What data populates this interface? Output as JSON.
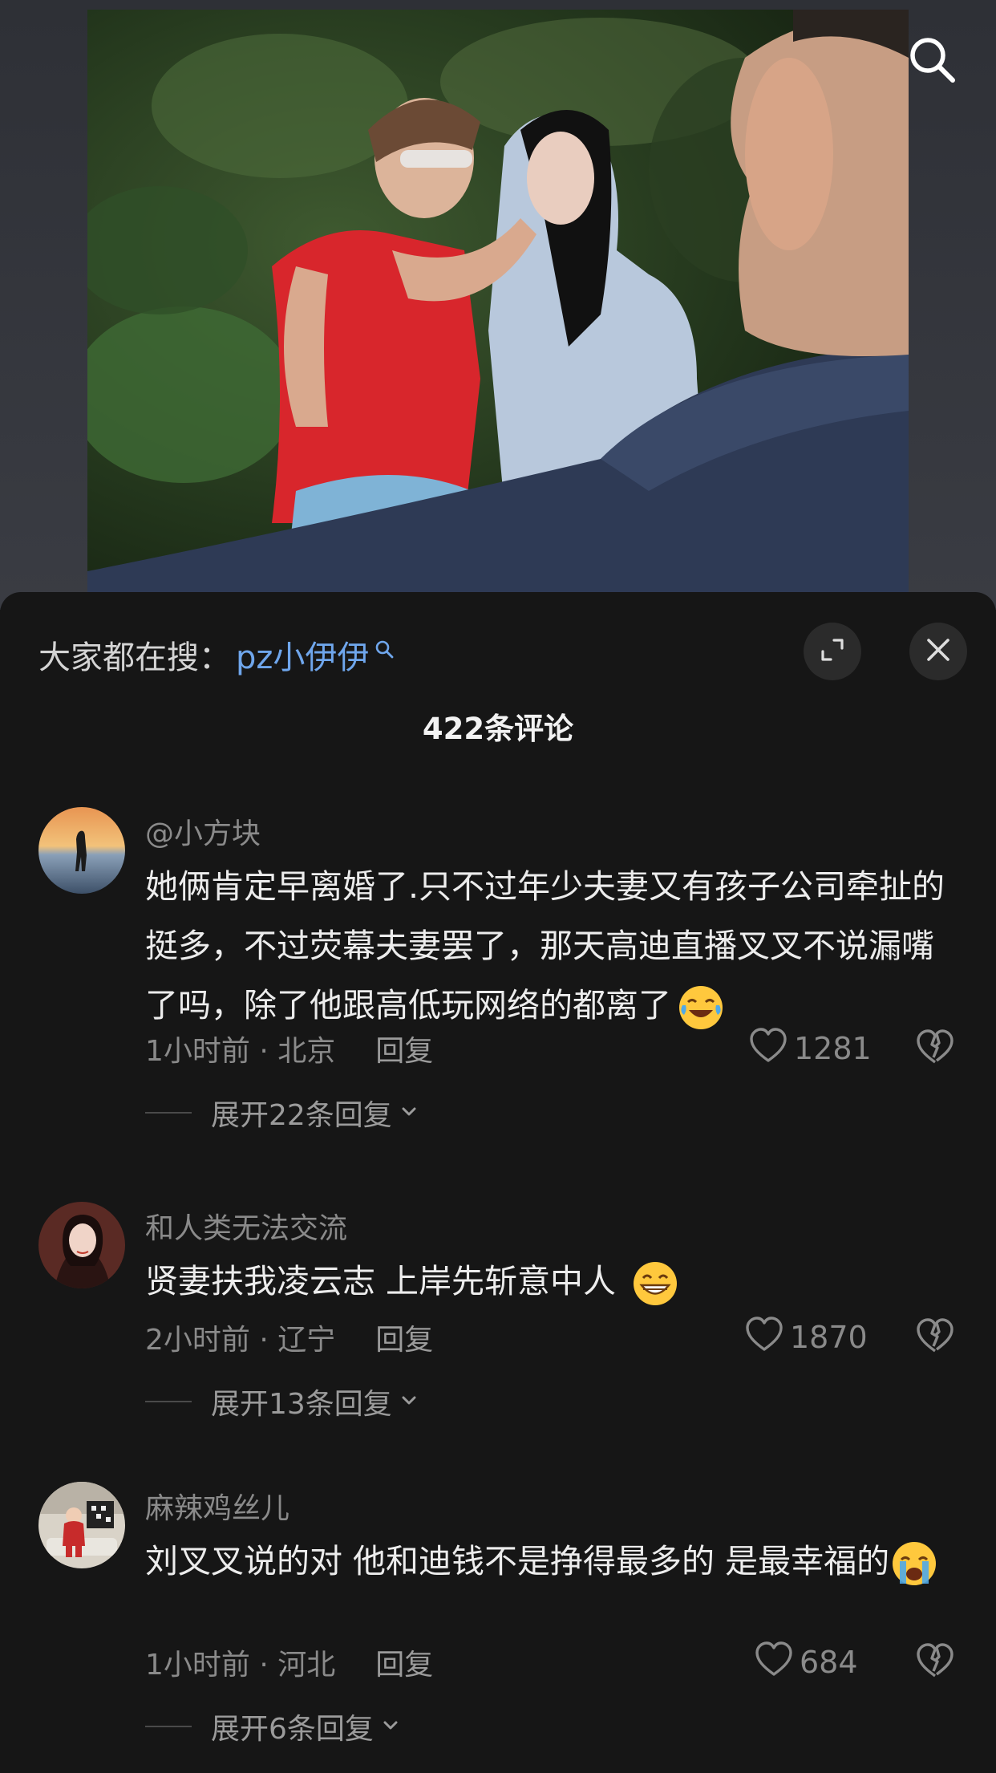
{
  "icons": {
    "search": "search-icon",
    "expand": "expand-icon",
    "close": "close-icon",
    "like": "heart-icon",
    "dislike": "broken-heart-icon",
    "chevron": "chevron-down-icon"
  },
  "colors": {
    "accent_link": "#6fa6ec",
    "sheet_bg": "#161616",
    "secondary_text": "#8a8a8a"
  },
  "search_suggestion": {
    "prefix": "大家都在搜：",
    "term": "pz小伊伊"
  },
  "comments_header": {
    "count_label": "422条评论"
  },
  "comments": [
    {
      "username": "@小方块",
      "text": "她俩肯定早离婚了.只不过年少夫妻又有孩子公司牵扯的挺多，不过荧幕夫妻罢了，那天高迪直播叉叉不说漏嘴了吗，除了他跟高低玩网络的都离了",
      "emoji": "laughing-crying-emoji",
      "time_location": "1小时前 · 北京",
      "reply_label": "回复",
      "likes": "1281",
      "expand_label": "展开22条回复"
    },
    {
      "username": "和人类无法交流",
      "text": "贤妻扶我凌云志 上岸先斩意中人",
      "emoji": "grinning-emoji",
      "time_location": "2小时前 · 辽宁",
      "reply_label": "回复",
      "likes": "1870",
      "expand_label": "展开13条回复"
    },
    {
      "username": "麻辣鸡丝儿",
      "text": "刘叉叉说的对 他和迪钱不是挣得最多的 是最幸福的",
      "emoji": "crying-emoji",
      "time_location": "1小时前 · 河北",
      "reply_label": "回复",
      "likes": "684",
      "expand_label": "展开6条回复"
    }
  ]
}
